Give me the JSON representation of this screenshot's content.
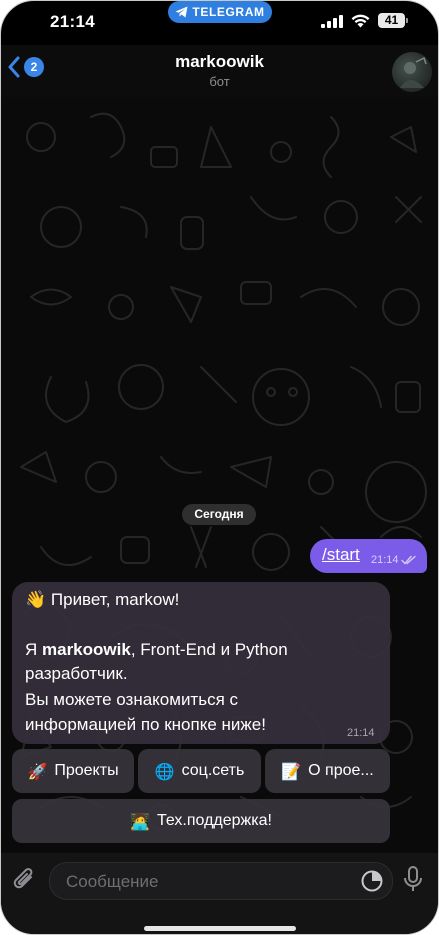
{
  "status_bar": {
    "time": "21:14",
    "app_pill": "TELEGRAM",
    "battery": "41"
  },
  "header": {
    "back_badge": "2",
    "title": "markoowik",
    "subtitle": "бот"
  },
  "chat": {
    "date_separator": "Сегодня",
    "outgoing": {
      "text": "/start",
      "time": "21:14"
    },
    "incoming": {
      "line1": "👋 Привет, markow!",
      "line2_prefix": "Я ",
      "line2_bold": "markoowik",
      "line2_suffix": ", Front-End и Python",
      "line3": "разработчик.",
      "line4": "Вы можете ознакомиться с",
      "line5": "информацией по кнопке ниже!",
      "time": "21:14"
    },
    "keyboard": {
      "row1": [
        {
          "emoji": "🚀",
          "label": "Проекты"
        },
        {
          "emoji": "🌐",
          "label": "соц.сеть"
        },
        {
          "emoji": "📝",
          "label": "О прое..."
        }
      ],
      "row2": [
        {
          "emoji": "🧑‍💻",
          "label": "Тех.поддержка!"
        }
      ]
    }
  },
  "input": {
    "placeholder": "Сообщение"
  },
  "colors": {
    "outgoing_bubble": "#7b5ce8",
    "incoming_bubble": "#342f3a",
    "accent": "#3a86e8",
    "telegram_pill": "#2f7fe0"
  },
  "icons": [
    "back-chevron-icon",
    "paper-plane-icon",
    "signal-icon",
    "wifi-icon",
    "battery-icon",
    "read-ticks-icon",
    "attach-clip-icon",
    "sticker-icon",
    "microphone-icon"
  ]
}
